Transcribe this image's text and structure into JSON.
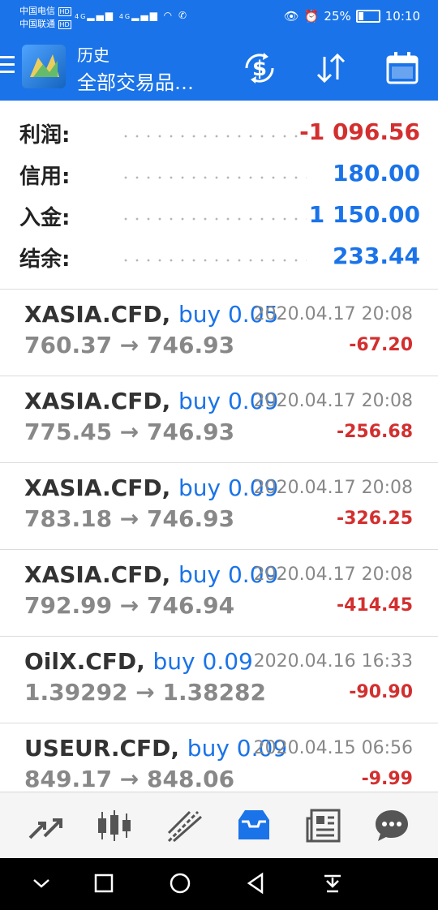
{
  "status_bar": {
    "carrier1": "中国电信",
    "carrier2": "中国联通",
    "hd": "HD",
    "net1": "4G",
    "net2": "4G",
    "battery_percent": "25%",
    "battery_level": 0.25,
    "time": "10:10"
  },
  "app_bar": {
    "title": "历史",
    "subtitle": "全部交易品…",
    "icons": [
      "menu-icon",
      "metatrader-logo",
      "currency-exchange-icon",
      "sort-icon",
      "calendar-icon"
    ]
  },
  "summary": [
    {
      "label": "利润:",
      "value": "-1 096.56",
      "color": "#d32f2f"
    },
    {
      "label": "信用:",
      "value": "180.00",
      "color": "#1a73e8"
    },
    {
      "label": "入金:",
      "value": "1 150.00",
      "color": "#1a73e8"
    },
    {
      "label": "结余:",
      "value": "233.44",
      "color": "#1a73e8"
    }
  ],
  "trades": [
    {
      "symbol": "XASIA.CFD,",
      "side": "buy 0.05",
      "time": "2020.04.17 20:08",
      "prices": "760.37 → 746.93",
      "profit": "-67.20"
    },
    {
      "symbol": "XASIA.CFD,",
      "side": "buy 0.09",
      "time": "2020.04.17 20:08",
      "prices": "775.45 → 746.93",
      "profit": "-256.68"
    },
    {
      "symbol": "XASIA.CFD,",
      "side": "buy 0.09",
      "time": "2020.04.17 20:08",
      "prices": "783.18 → 746.93",
      "profit": "-326.25"
    },
    {
      "symbol": "XASIA.CFD,",
      "side": "buy 0.09",
      "time": "2020.04.17 20:08",
      "prices": "792.99 → 746.94",
      "profit": "-414.45"
    },
    {
      "symbol": "OilX.CFD,",
      "side": "buy 0.09",
      "time": "2020.04.16 16:33",
      "prices": "1.39292 → 1.38282",
      "profit": "-90.90"
    },
    {
      "symbol": "USEUR.CFD,",
      "side": "buy 0.09",
      "time": "2020.04.15 06:56",
      "prices": "849.17 → 848.06",
      "profit": "-9.99"
    }
  ],
  "bottom_nav": {
    "items": [
      "quotes-icon",
      "chart-icon",
      "trade-icon",
      "history-icon",
      "news-icon",
      "messages-icon"
    ],
    "active": "history-icon",
    "active_color": "#1a73e8"
  },
  "colors": {
    "brand": "#1a73e8",
    "loss": "#d32f2f",
    "muted": "#888888"
  }
}
